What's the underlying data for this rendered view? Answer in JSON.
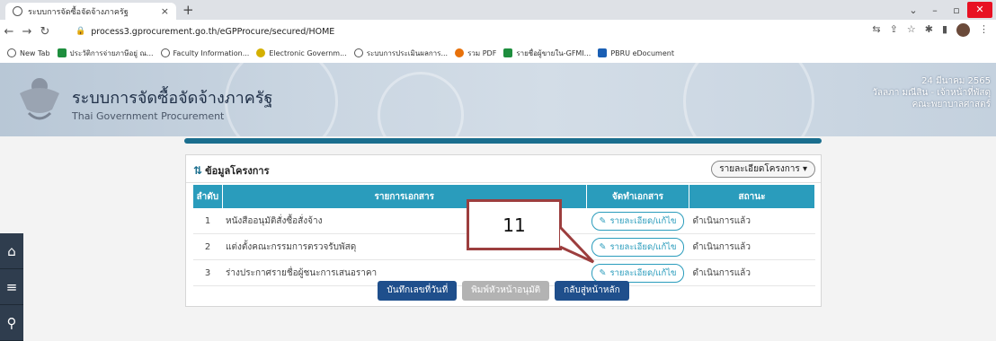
{
  "browser": {
    "tab_title": "ระบบการจัดซื้อจัดจ้างภาครัฐ",
    "tab_close": "×",
    "new_tab": "+",
    "url": "process3.gprocurement.go.th/eGPProcure/secured/HOME",
    "bookmarks": [
      {
        "label": "New Tab",
        "icon": "globe-icon",
        "color": "#555555"
      },
      {
        "label": "ประวัติการจ่ายภาษีอยู่ ณ...",
        "icon": "sheet-icon",
        "color": "#1e8e3e"
      },
      {
        "label": "Faculty Information...",
        "icon": "globe-icon",
        "color": "#555555"
      },
      {
        "label": "Electronic Governm...",
        "icon": "leaf-icon",
        "color": "#d4b000"
      },
      {
        "label": "ระบบการประเมินผลการ...",
        "icon": "globe-icon",
        "color": "#555555"
      },
      {
        "label": "รวม PDF",
        "icon": "dots-icon",
        "color": "#e8710a"
      },
      {
        "label": "รายชื่อผู้ขายใน-GFMI...",
        "icon": "sheet-icon",
        "color": "#1e8e3e"
      },
      {
        "label": "PBRU eDocument",
        "icon": "doc-icon",
        "color": "#1a5fb4"
      }
    ]
  },
  "header": {
    "title_th": "ระบบการจัดซื้อจัดจ้างภาครัฐ",
    "title_en": "Thai Government Procurement",
    "date": "24 มีนาคม 2565",
    "user": "วัลลภา มณีสิน - เจ้าหน้าที่พัสดุ",
    "org": "คณะพยาบาลศาสตร์"
  },
  "panel": {
    "title": "ข้อมูลโครงการ",
    "detail_button": "รายละเอียดโครงการ",
    "columns": [
      "ลำดับ",
      "รายการเอกสาร",
      "จัดทำเอกสาร",
      "สถานะ"
    ],
    "rows": [
      {
        "no": "1",
        "name": "หนังสืออนุมัติสั่งซื้อสั่งจ้าง",
        "action": "รายละเอียด/แก้ไข",
        "status": "ดำเนินการแล้ว"
      },
      {
        "no": "2",
        "name": "แต่งตั้งคณะกรรมการตรวจรับพัสดุ",
        "action": "รายละเอียด/แก้ไข",
        "status": "ดำเนินการแล้ว"
      },
      {
        "no": "3",
        "name": "ร่างประกาศรายชื่อผู้ชนะการเสนอราคา",
        "action": "รายละเอียด/แก้ไข",
        "status": "ดำเนินการแล้ว"
      }
    ],
    "buttons": {
      "save": "บันทึกเลขที่วันที่",
      "print": "พิมพ์หัวหน้าอนุมัติ",
      "back": "กลับสู่หน้าหลัก"
    }
  },
  "annotation": {
    "label": "11"
  },
  "colors": {
    "accent": "#2a9cbc",
    "primary_button": "#1f4f8c",
    "callout_border": "#9c3e3e"
  }
}
